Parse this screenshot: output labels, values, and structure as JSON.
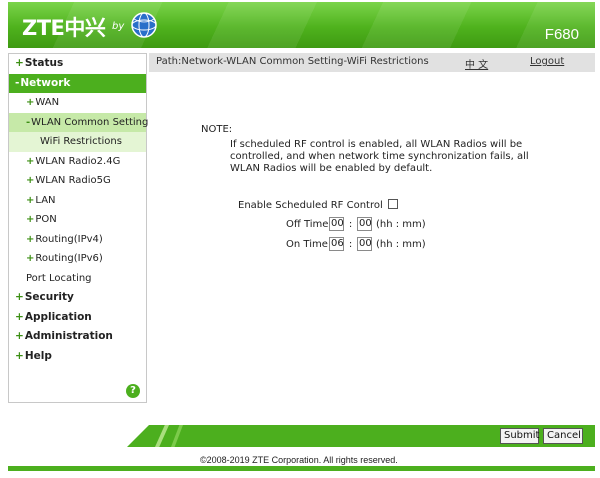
{
  "header": {
    "brand": "ZTE中兴",
    "by": "by",
    "model": "F680"
  },
  "sidebar": {
    "items": [
      {
        "sign": "+",
        "label": "Status"
      },
      {
        "sign": "-",
        "label": "Network"
      },
      {
        "sign": "+",
        "label": "WAN"
      },
      {
        "sign": "-",
        "label": "WLAN Common Setting"
      },
      {
        "sign": "",
        "label": "WiFi Restrictions"
      },
      {
        "sign": "+",
        "label": "WLAN Radio2.4G"
      },
      {
        "sign": "+",
        "label": "WLAN Radio5G"
      },
      {
        "sign": "+",
        "label": "LAN"
      },
      {
        "sign": "+",
        "label": "PON"
      },
      {
        "sign": "+",
        "label": "Routing(IPv4)"
      },
      {
        "sign": "+",
        "label": "Routing(IPv6)"
      },
      {
        "sign": "",
        "label": "Port Locating"
      },
      {
        "sign": "+",
        "label": "Security"
      },
      {
        "sign": "+",
        "label": "Application"
      },
      {
        "sign": "+",
        "label": "Administration"
      },
      {
        "sign": "+",
        "label": "Help"
      }
    ],
    "help_icon": "?"
  },
  "pathbar": {
    "path": "Path:Network-WLAN Common Setting-WiFi Restrictions",
    "language": "中 文",
    "logout": "Logout"
  },
  "content": {
    "note_label": "NOTE:",
    "note_text": "If scheduled RF control is enabled, all WLAN Radios will be controlled, and when network time synchronization fails, all WLAN Radios will be enabled by default.",
    "enable_label": "Enable Scheduled RF Control",
    "enable_checked": false,
    "off_time": {
      "label": "Off Time",
      "hour": "00",
      "minute": "00",
      "hint": "(hh : mm)"
    },
    "on_time": {
      "label": "On Time",
      "hour": "06",
      "minute": "00",
      "hint": "(hh : mm)"
    }
  },
  "footer": {
    "submit": "Submit",
    "cancel": "Cancel",
    "copyright": "©2008-2019 ZTE Corporation. All rights reserved."
  },
  "colors": {
    "accent": "#4caf1e",
    "accent_light": "#c6e9a8"
  }
}
